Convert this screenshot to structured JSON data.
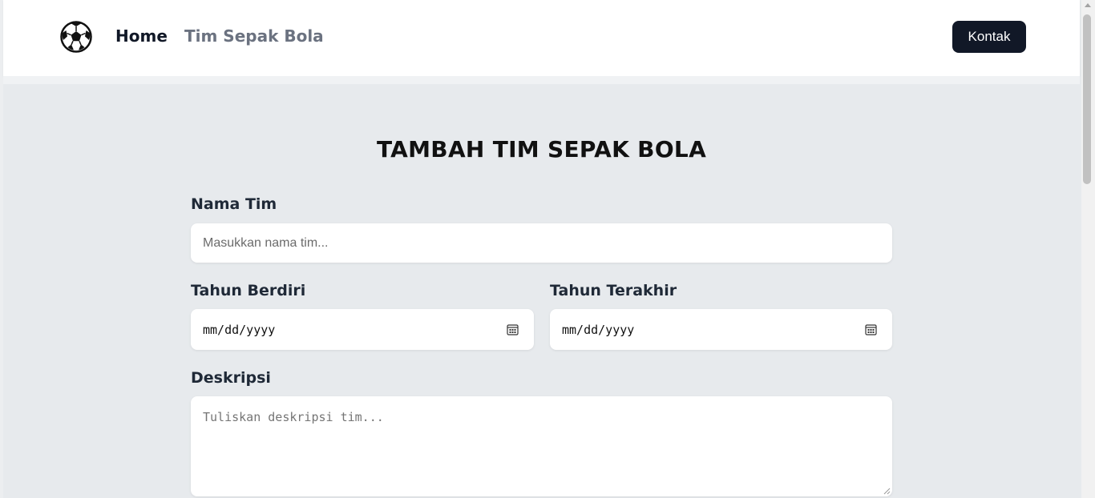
{
  "nav": {
    "logo_icon": "soccer-ball-icon",
    "home_label": "Home",
    "teams_label": "Tim Sepak Bola",
    "contact_label": "Kontak"
  },
  "form": {
    "title": "TAMBAH TIM SEPAK BOLA",
    "name_label": "Nama Tim",
    "name_placeholder": "Masukkan nama tim...",
    "founded_label": "Tahun Berdiri",
    "founded_placeholder": "mm/dd/yyyy",
    "last_label": "Tahun Terakhir",
    "last_placeholder": "mm/dd/yyyy",
    "desc_label": "Deskripsi",
    "desc_placeholder": "Tuliskan deskripsi tim..."
  },
  "colors": {
    "background": "#e7eaed",
    "nav_text_active": "#111827",
    "nav_text_muted": "#6b7280",
    "button_bg": "#111827"
  }
}
